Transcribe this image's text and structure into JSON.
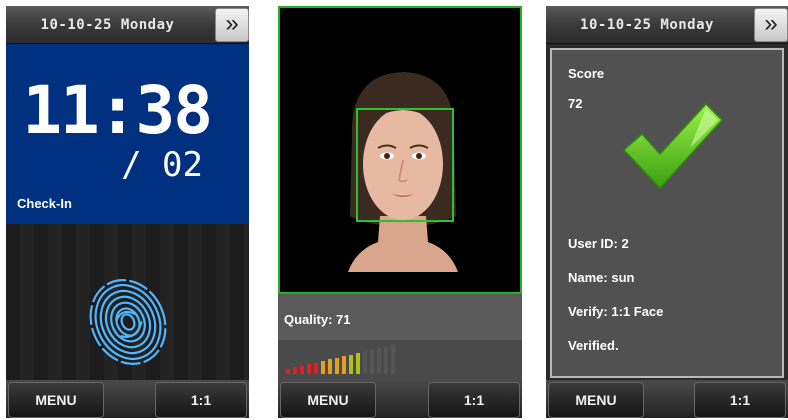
{
  "screen1": {
    "topbar": {
      "date": "10-10-25   Monday",
      "more_label": "»"
    },
    "clock": {
      "time": "11:38",
      "day": "/ 02"
    },
    "status": "Check-In",
    "bottombar": {
      "menu": "MENU",
      "mode": "1:1"
    }
  },
  "screen2": {
    "quality_label": "Quality: 71",
    "quality_meter": {
      "level": 0.71,
      "bar_count": 16
    },
    "bottombar": {
      "menu": "MENU",
      "mode": "1:1"
    }
  },
  "screen3": {
    "topbar": {
      "date": "10-10-25   Monday",
      "more_label": "»"
    },
    "score_label": "Score",
    "score_value": "72",
    "user_id": "User ID: 2",
    "name": "Name: sun",
    "verify": "Verify: 1:1 Face",
    "result": "Verified.",
    "bottombar": {
      "menu": "MENU",
      "mode": "1:1"
    }
  },
  "colors": {
    "clock_bg": "#003080",
    "face_frame": "#2ec12e",
    "check": "#5fcf1a"
  }
}
